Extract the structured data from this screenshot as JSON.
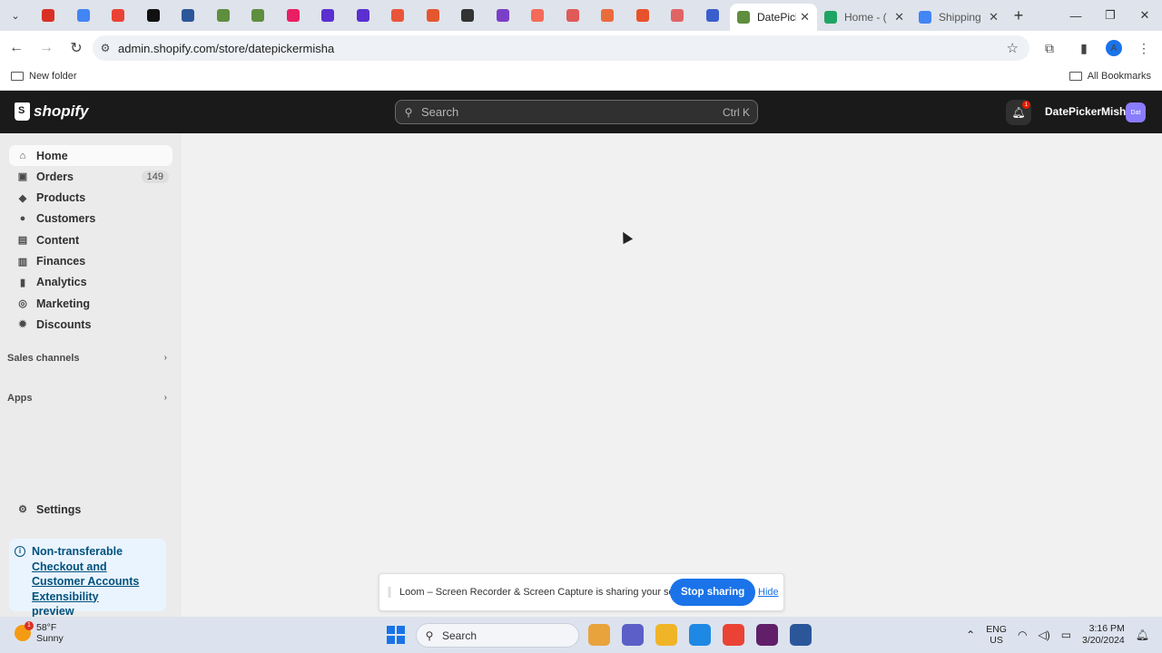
{
  "browser": {
    "pinned_colors": [
      "#d93025",
      "#4285f4",
      "#ea4335",
      "#111111",
      "#2b579a",
      "#5e8e3e",
      "#5e8e3e",
      "#e91e63",
      "#5b2fd0",
      "#5b2fd0",
      "#e8553b",
      "#e4572e",
      "#333333",
      "#7b3fc7",
      "#f56b5a",
      "#e05a5a",
      "#ea6b3c",
      "#e8522b",
      "#e06464",
      "#3a5fcd"
    ],
    "tabs": [
      {
        "title": "DatePick",
        "favicon_color": "#5e8e3e",
        "active": true
      },
      {
        "title": "Home - (",
        "favicon_color": "#1fa463",
        "active": false
      },
      {
        "title": "Shipping",
        "favicon_color": "#4285f4",
        "active": false
      }
    ],
    "new_tab_icon": "+",
    "url": "admin.shopify.com/store/datepickermisha",
    "profile_initial": "A",
    "bookmarks": {
      "left": "New folder",
      "right": "All Bookmarks"
    }
  },
  "topbar": {
    "brand": "shopify",
    "search_placeholder": "Search",
    "search_shortcut": "Ctrl K",
    "notification_count": "1",
    "store_name": "DatePickerMisha",
    "store_avatar": "Dat"
  },
  "sidebar": {
    "items": [
      {
        "label": "Home",
        "icon": "home-icon",
        "glyph": "⌂"
      },
      {
        "label": "Orders",
        "icon": "orders-icon",
        "glyph": "▣",
        "count": "149"
      },
      {
        "label": "Products",
        "icon": "tag-icon",
        "glyph": "◆"
      },
      {
        "label": "Customers",
        "icon": "person-icon",
        "glyph": "●"
      },
      {
        "label": "Content",
        "icon": "image-icon",
        "glyph": "▤"
      },
      {
        "label": "Finances",
        "icon": "bank-icon",
        "glyph": "▥"
      },
      {
        "label": "Analytics",
        "icon": "bar-chart-icon",
        "glyph": "▮"
      },
      {
        "label": "Marketing",
        "icon": "target-icon",
        "glyph": "◎"
      },
      {
        "label": "Discounts",
        "icon": "discount-icon",
        "glyph": "✹"
      }
    ],
    "sections": [
      "Sales channels",
      "Apps"
    ],
    "settings_label": "Settings",
    "notice": {
      "title": "Non-transferable",
      "link": "Checkout and Customer Accounts Extensibility",
      "suffix": "preview"
    }
  },
  "loom": {
    "message": "Loom – Screen Recorder & Screen Capture is sharing your screen.",
    "stop_label": "Stop sharing",
    "hide_label": "Hide"
  },
  "taskbar": {
    "temperature": "58°F",
    "condition": "Sunny",
    "weather_badge": "1",
    "search_label": "Search",
    "language_line1": "ENG",
    "language_line2": "US",
    "time": "3:16 PM",
    "date": "3/20/2024",
    "app_colors": [
      "#e8a33d",
      "#5b5fc7",
      "#f0b429",
      "#1e88e5",
      "#ea4335",
      "#611f69",
      "#2b579a"
    ]
  }
}
